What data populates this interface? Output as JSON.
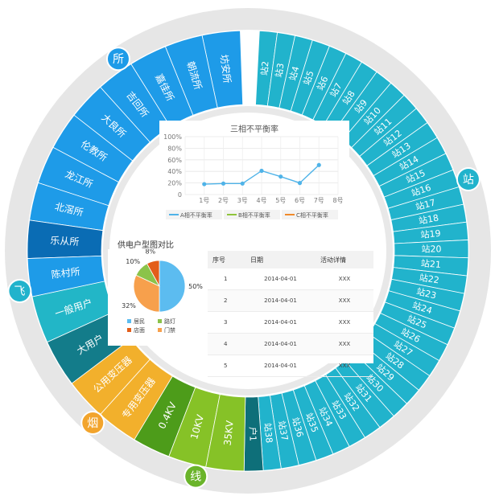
{
  "categories": {
    "suo": {
      "label": "所",
      "items": [
        "坊安所",
        "朝流所",
        "嘉佳所",
        "吉回所",
        "大良所",
        "伦教所",
        "龙江所",
        "北滘所",
        "乐从所",
        "陈村所"
      ]
    },
    "fei": {
      "label": "飞",
      "items": [
        "一般用户",
        "大用户"
      ]
    },
    "yan": {
      "label": "烟",
      "items": [
        "公用变压器",
        "专用变压器"
      ]
    },
    "xian": {
      "label": "线",
      "items": [
        "0.4KV",
        "10KV",
        "35KV"
      ]
    },
    "hu": {
      "items": [
        "户1"
      ]
    },
    "zhan": {
      "label": "站",
      "items": [
        "站2",
        "站3",
        "站4",
        "站5",
        "站6",
        "站7",
        "站8",
        "站9",
        "站10",
        "站11",
        "站12",
        "站13",
        "站14",
        "站15",
        "站16",
        "站17",
        "站18",
        "站19",
        "站20",
        "站21",
        "站22",
        "站23",
        "站24",
        "站25",
        "站26",
        "站27",
        "站28",
        "站29",
        "站30",
        "站31",
        "站32",
        "站33",
        "站34",
        "站35",
        "站36",
        "站37",
        "站38"
      ]
    }
  },
  "colors": {
    "suo": "#1e9be8",
    "suo_dark": "#0a6cb4",
    "fei_light": "#22b6c7",
    "fei_dark": "#137c8a",
    "yan": "#f2b02c",
    "xian_dark": "#4d9c1a",
    "xian_light": "#86c227",
    "hu": "#0e6f79",
    "zhan": "#21b3cc",
    "ring": "#e3e3e3"
  },
  "line_chart": {
    "title": "三相不平衡率",
    "chart_data": {
      "type": "line",
      "categories": [
        "",
        "1号",
        "2号",
        "3号",
        "4号",
        "5号",
        "6号",
        "7号",
        "8号"
      ],
      "y_ticks": [
        "0",
        "20%",
        "40%",
        "60%",
        "80%",
        "100%"
      ],
      "ylim": [
        0,
        100
      ],
      "series": [
        {
          "name": "A相不平衡率",
          "color": "#4fb3e8",
          "values": [
            null,
            18,
            19,
            19,
            41,
            31,
            20,
            51,
            null,
            null
          ]
        },
        {
          "name": "B相不平衡率",
          "color": "#8fc43b",
          "values": []
        },
        {
          "name": "C相不平衡率",
          "color": "#f08a2b",
          "values": []
        }
      ]
    }
  },
  "pie_chart": {
    "title": "供电户型图对比",
    "chart_data": {
      "type": "pie",
      "labels": [
        "居民",
        "路灯",
        "店面",
        "门禁"
      ],
      "values": [
        50,
        10,
        8,
        32
      ],
      "value_labels": [
        "50%",
        "10%",
        "8%",
        "32%"
      ],
      "colors": [
        "#5cbcf0",
        "#8bc34a",
        "#e35d1a",
        "#f7a04c"
      ]
    }
  },
  "table": {
    "headers": [
      "序号",
      "日期",
      "活动详情"
    ],
    "rows": [
      [
        "1",
        "2014-04-01",
        "XXX"
      ],
      [
        "2",
        "2014-04-01",
        "XXX"
      ],
      [
        "3",
        "2014-04-01",
        "XXX"
      ],
      [
        "4",
        "2014-04-01",
        "XXX"
      ],
      [
        "5",
        "2014-04-01",
        "XXX"
      ]
    ]
  }
}
